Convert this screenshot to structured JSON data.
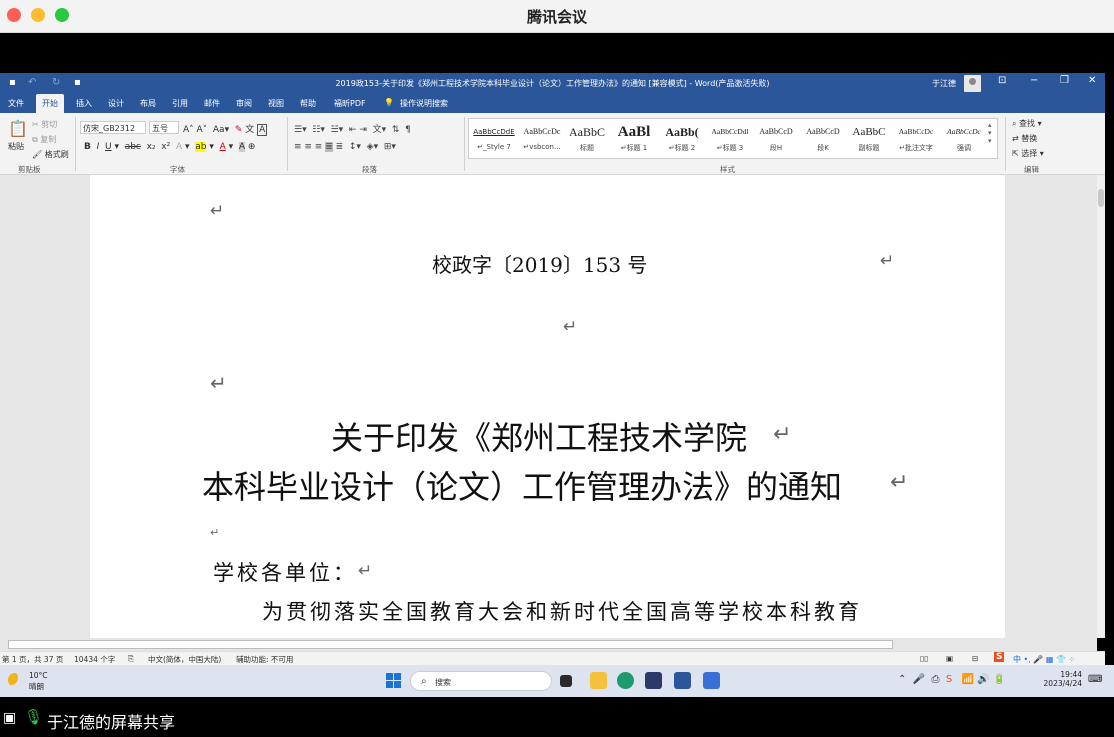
{
  "window": {
    "title": "腾讯会议"
  },
  "word": {
    "doc_title": "2019政153-关于印发《郑州工程技术学院本科毕业设计（论文）工作管理办法》的通知 [兼容模式] - Word(产品激活失败)",
    "user_name": "于江德",
    "tabs": [
      "文件",
      "开始",
      "插入",
      "设计",
      "布局",
      "引用",
      "邮件",
      "审阅",
      "视图",
      "帮助",
      "福昕PDF",
      "操作说明搜索"
    ],
    "clipboard": {
      "paste": "粘贴",
      "cut": "剪切",
      "copy": "复制",
      "format_painter": "格式刷",
      "label": "剪贴板"
    },
    "font": {
      "name": "仿宋_GB2312",
      "size": "五号",
      "label": "字体"
    },
    "paragraph_label": "段落",
    "styles": [
      {
        "sample": "AaBbCcDdE",
        "name": "↵_Style 7"
      },
      {
        "sample": "AaBbCcDc",
        "name": "↵vsbcon..."
      },
      {
        "sample": "AaBbC",
        "name": "标题"
      },
      {
        "sample": "AaBl",
        "name": "↵标题 1"
      },
      {
        "sample": "AaBb(",
        "name": "↵标题 2"
      },
      {
        "sample": "AaBbCcDdl",
        "name": "↵标题 3"
      },
      {
        "sample": "AaBbCcD",
        "name": "段H"
      },
      {
        "sample": "AaBbCcD",
        "name": "段K"
      },
      {
        "sample": "AaBbC",
        "name": "副标题"
      },
      {
        "sample": "AaBbCcDc",
        "name": "↵批注文字"
      },
      {
        "sample": "AaBbCcDc",
        "name": "强调"
      }
    ],
    "styles_label": "样式",
    "editing": {
      "find": "查找",
      "replace": "替换",
      "select": "选择",
      "label": "编辑"
    }
  },
  "doc": {
    "doc_number": "校政字〔2019〕153 号",
    "title_line1": "关于印发《郑州工程技术学院",
    "title_line2": "本科毕业设计（论文）工作管理办法》的通知",
    "salutation": "学校各单位：",
    "body": "为贯彻落实全国教育大会和新时代全国高等学校本科教育",
    "para_mark": "↵"
  },
  "status": {
    "page": "第 1 页，共 37 页",
    "words": "10434 个字",
    "lang": "中文(简体，中国大陆)",
    "accessibility": "辅助功能: 不可用"
  },
  "taskbar": {
    "temp": "10°C",
    "weather": "晴朗",
    "search": "搜索",
    "time": "19:44",
    "date": "2023/4/24"
  },
  "share": {
    "text": "于江德的屏幕共享"
  }
}
